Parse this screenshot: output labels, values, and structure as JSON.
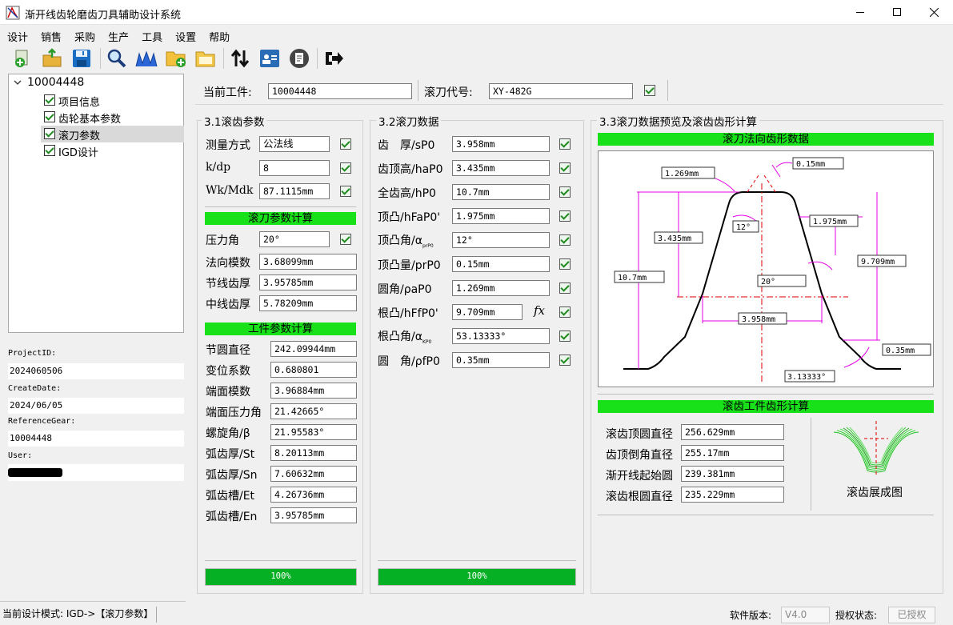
{
  "window": {
    "title": "渐开线齿轮磨齿刀具辅助设计系统"
  },
  "menu": [
    "设计",
    "销售",
    "采购",
    "生产",
    "工具",
    "设置",
    "帮助"
  ],
  "toolbar_icons": [
    "new-icon",
    "open-icon",
    "save-icon",
    "search-icon",
    "tooth-profile-icon",
    "add-folder-icon",
    "folder-icon",
    "sort-icon",
    "id-card-icon",
    "report-icon",
    "exit-icon"
  ],
  "tree": {
    "root": "10004448",
    "items": [
      "项目信息",
      "齿轮基本参数",
      "滚刀参数",
      "IGD设计"
    ],
    "selected": "滚刀参数"
  },
  "info": {
    "project_id_label": "ProjectID:",
    "project_id": "2024060506",
    "create_date_label": "CreateDate:",
    "create_date": "2024/06/05",
    "reference_gear_label": "ReferenceGear:",
    "reference_gear": "10004448",
    "user_label": "User:"
  },
  "header": {
    "workpiece_label": "当前工件:",
    "workpiece": "10004448",
    "hob_code_label": "滚刀代号:",
    "hob_code": "XY-482G"
  },
  "s31": {
    "title": "3.1滚齿参数",
    "measure": [
      {
        "label": "测量方式",
        "value": "公法线"
      },
      {
        "label": "k/dp",
        "value": "8"
      },
      {
        "label": "Wk/Mdk",
        "value": "87.1115mm"
      }
    ],
    "calc_bar": "滚刀参数计算",
    "hob": [
      {
        "label": "压力角",
        "value": "20°"
      },
      {
        "label": "法向模数",
        "value": "3.68099mm"
      },
      {
        "label": "节线齿厚",
        "value": "3.95785mm"
      },
      {
        "label": "中线齿厚",
        "value": "5.78209mm"
      }
    ],
    "work_bar": "工件参数计算",
    "work": [
      {
        "label": "节圆直径",
        "value": "242.09944mm"
      },
      {
        "label": "变位系数",
        "value": "0.680801"
      },
      {
        "label": "端面模数",
        "value": "3.96884mm"
      },
      {
        "label": "端面压力角",
        "value": "21.42665°"
      },
      {
        "label": "螺旋角/β",
        "value": "21.95583°"
      },
      {
        "label": "弧齿厚/St",
        "value": "8.20113mm"
      },
      {
        "label": "弧齿厚/Sn",
        "value": "7.60632mm"
      },
      {
        "label": "弧齿槽/Et",
        "value": "4.26736mm"
      },
      {
        "label": "弧齿槽/En",
        "value": "3.95785mm"
      }
    ],
    "progress": {
      "text": "100%",
      "value": 1.0
    }
  },
  "s32": {
    "title": "3.2滚刀数据",
    "rows": [
      {
        "label": "齿　厚/sP0",
        "value": "3.958mm"
      },
      {
        "label": "齿顶高/haP0",
        "value": "3.435mm"
      },
      {
        "label": "全齿高/hP0",
        "value": "10.7mm"
      },
      {
        "label": "顶凸/hFaP0'",
        "value": "1.975mm"
      },
      {
        "label": "顶凸角/α",
        "sub": "prP0",
        "value": "12°"
      },
      {
        "label": "顶凸量/prP0",
        "value": "0.15mm"
      },
      {
        "label": "圆角/ρaP0",
        "value": "1.269mm"
      },
      {
        "label": "根凸/hFfP0'",
        "value": "9.709mm"
      },
      {
        "label": "根凸角/α",
        "sub": "KP0",
        "value": "53.13333°"
      },
      {
        "label": "圆　角/ρfP0",
        "value": "0.35mm"
      }
    ],
    "fx_icon": "fx",
    "progress": {
      "text": "100%",
      "value": 1.0
    }
  },
  "s33": {
    "title": "3.3滚刀数据预览及滚齿齿形计算",
    "profile_bar": "滚刀法向齿形数据",
    "dims": {
      "r_top": "1.269mm",
      "pr": "0.15mm",
      "angle12": "12°",
      "hfa": "1.975mm",
      "ha": "3.435mm",
      "hfull": "10.7mm",
      "hff": "9.709mm",
      "angle20": "20°",
      "sp": "3.958mm",
      "rf": "0.35mm",
      "angle53": "3.13333°"
    },
    "gen_bar": "滚齿工件齿形计算",
    "gen": [
      {
        "label": "滚齿顶圆直径",
        "value": "256.629mm"
      },
      {
        "label": "齿顶倒角直径",
        "value": "255.17mm"
      },
      {
        "label": "渐开线起始圆",
        "value": "239.381mm"
      },
      {
        "label": "滚齿根圆直径",
        "value": "235.229mm"
      }
    ],
    "gen_caption": "滚齿展成图"
  },
  "status": {
    "mode": "当前设计模式: IGD->【滚刀参数】",
    "version_label": "软件版本:",
    "version": "V4.0",
    "license_label": "授权状态:",
    "license": "已授权"
  },
  "colors": {
    "accent_green": "#19e119",
    "progress_green": "#06b025",
    "dim_magenta": "#e400e4",
    "center_red": "#e00000"
  }
}
